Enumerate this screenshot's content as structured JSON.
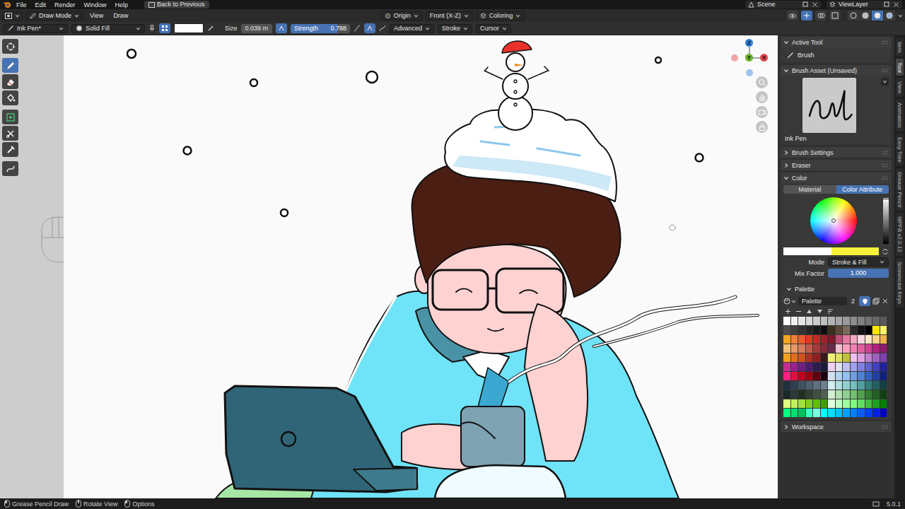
{
  "menu_bar": {
    "items": [
      "File",
      "Edit",
      "Render",
      "Window",
      "Help"
    ],
    "back_button": "Back to Previous",
    "scene": "Scene",
    "view_layer": "ViewLayer"
  },
  "header": {
    "mode": "Draw Mode",
    "menus": [
      "View",
      "Draw"
    ],
    "pivot": "Origin",
    "view": "Front (X-Z)",
    "layer": "Coloring",
    "shading": [
      {
        "selected": false
      },
      {
        "selected": false
      },
      {
        "selected": true
      },
      {
        "selected": false
      }
    ]
  },
  "tool_settings": {
    "brush": "Ink Pen*",
    "fill": "Solid Fill",
    "brush_color": "#ffffff",
    "size_label": "Size",
    "size": "0.039 m",
    "strength_label": "Strength",
    "strength": "0.788",
    "strength_level": 0.788,
    "menus": [
      "Advanced",
      "Stroke",
      "Cursor"
    ]
  },
  "toolbar": {
    "tools": [
      {
        "kind": "cursor",
        "selected": false
      },
      {
        "kind": "draw",
        "selected": true
      },
      {
        "kind": "erase",
        "selected": false
      },
      {
        "kind": "fill",
        "selected": false
      },
      {
        "kind": "tint",
        "selected": false
      },
      {
        "kind": "cutter",
        "selected": false
      },
      {
        "kind": "eyedropper",
        "selected": false
      },
      {
        "kind": "interpolate",
        "selected": false
      }
    ]
  },
  "gizmo": {
    "axes": [
      {
        "label": "Z",
        "color": "#2f7fdb"
      },
      {
        "label": "Y",
        "color": "#6cb32c"
      },
      {
        "label": "X",
        "color": "#e0474c"
      }
    ]
  },
  "sidebar": {
    "tabs": [
      {
        "label": "Item",
        "selected": false
      },
      {
        "label": "Tool",
        "selected": true
      },
      {
        "label": "View",
        "selected": false
      },
      {
        "label": "Animation",
        "selected": false
      },
      {
        "label": "Easy Tree",
        "selected": false
      },
      {
        "label": "Grease Pencil",
        "selected": false
      },
      {
        "label": "MPFB v2.0.12",
        "selected": false
      },
      {
        "label": "Screencast Keys",
        "selected": false
      }
    ],
    "active_tool": {
      "title": "Active Tool",
      "expanded": true,
      "tool": "Brush"
    },
    "brush_asset": {
      "title": "Brush Asset (Unsaved)",
      "expanded": true,
      "name": "Ink Pen"
    },
    "brush_settings": {
      "title": "Brush Settings",
      "expanded": false
    },
    "eraser": {
      "title": "Eraser",
      "expanded": false
    },
    "color": {
      "title": "Color",
      "expanded": true,
      "tabs": [
        {
          "label": "Material",
          "selected": false
        },
        {
          "label": "Color Attribute",
          "selected": true
        }
      ],
      "value_level": 1,
      "colors": [
        {
          "color": "#ffffff"
        },
        {
          "color": "#f6f23a"
        }
      ],
      "mode_label": "Mode",
      "mode": "Stroke & Fill",
      "mix_label": "Mix Factor",
      "mix": "1.000",
      "mix_level": 1,
      "palette": {
        "title": "Palette",
        "expanded": true,
        "name": "Palette",
        "users": "2",
        "swatches": [
          {
            "color": "#ffffff",
            "selected": true
          },
          {
            "color": "#f2f2f2",
            "selected": false
          },
          {
            "color": "#e6e6e6",
            "selected": false
          },
          {
            "color": "#d9d9d9",
            "selected": false
          },
          {
            "color": "#cccccc",
            "selected": false
          },
          {
            "color": "#bfbfbf",
            "selected": false
          },
          {
            "color": "#b3b3b3",
            "selected": false
          },
          {
            "color": "#a6a6a6",
            "selected": false
          },
          {
            "color": "#999999",
            "selected": false
          },
          {
            "color": "#8c8c8c",
            "selected": false
          },
          {
            "color": "#808080",
            "selected": false
          },
          {
            "color": "#737373",
            "selected": false
          },
          {
            "color": "#666666",
            "selected": false
          },
          {
            "color": "#595959",
            "selected": false
          },
          {
            "color": "#4d4d4d",
            "selected": false
          },
          {
            "color": "#404040",
            "selected": false
          },
          {
            "color": "#333333",
            "selected": false
          },
          {
            "color": "#262626",
            "selected": false
          },
          {
            "color": "#1a1a1a",
            "selected": false
          },
          {
            "color": "#0d0d0d",
            "selected": false
          },
          {
            "color": "#3a2e1e",
            "selected": false
          },
          {
            "color": "#5a4a3a",
            "selected": false
          },
          {
            "color": "#7a6a5a",
            "selected": false
          },
          {
            "color": "#2a2a2a",
            "selected": false
          },
          {
            "color": "#111111",
            "selected": false
          },
          {
            "color": "#000000",
            "selected": false
          },
          {
            "color": "#ffe600",
            "selected": false
          },
          {
            "color": "#fff26b",
            "selected": false
          },
          {
            "color": "#f5a623",
            "selected": false
          },
          {
            "color": "#f07f3c",
            "selected": false
          },
          {
            "color": "#e85d2a",
            "selected": false
          },
          {
            "color": "#e03c1f",
            "selected": false
          },
          {
            "color": "#c62828",
            "selected": false
          },
          {
            "color": "#a01f2a",
            "selected": false
          },
          {
            "color": "#7a1a2a",
            "selected": false
          },
          {
            "color": "#c0507a",
            "selected": false
          },
          {
            "color": "#e27aa0",
            "selected": false
          },
          {
            "color": "#f2a7c0",
            "selected": false
          },
          {
            "color": "#f7d6e0",
            "selected": false
          },
          {
            "color": "#fbe6c8",
            "selected": false
          },
          {
            "color": "#f5d08a",
            "selected": false
          },
          {
            "color": "#f0b44a",
            "selected": false
          },
          {
            "color": "#f3c27a",
            "selected": false
          },
          {
            "color": "#e89a6a",
            "selected": false
          },
          {
            "color": "#d77a5a",
            "selected": false
          },
          {
            "color": "#c45a4a",
            "selected": false
          },
          {
            "color": "#a63a3a",
            "selected": false
          },
          {
            "color": "#8a2a3a",
            "selected": false
          },
          {
            "color": "#6a2a4a",
            "selected": false
          },
          {
            "color": "#f0c0d0",
            "selected": false
          },
          {
            "color": "#f7a0c0",
            "selected": false
          },
          {
            "color": "#f080b0",
            "selected": false
          },
          {
            "color": "#e060a0",
            "selected": false
          },
          {
            "color": "#d04090",
            "selected": false
          },
          {
            "color": "#b02080",
            "selected": false
          },
          {
            "color": "#901a70",
            "selected": false
          },
          {
            "color": "#f0a020",
            "selected": false
          },
          {
            "color": "#e07020",
            "selected": false
          },
          {
            "color": "#d05020",
            "selected": false
          },
          {
            "color": "#b03020",
            "selected": false
          },
          {
            "color": "#902020",
            "selected": false
          },
          {
            "color": "#3a1a1a",
            "selected": false
          },
          {
            "color": "#f0f080",
            "selected": false
          },
          {
            "color": "#e0e060",
            "selected": false
          },
          {
            "color": "#c0c040",
            "selected": false
          },
          {
            "color": "#f0c0f0",
            "selected": false
          },
          {
            "color": "#e0a0e0",
            "selected": false
          },
          {
            "color": "#c080d0",
            "selected": false
          },
          {
            "color": "#a060c0",
            "selected": false
          },
          {
            "color": "#8040b0",
            "selected": false
          },
          {
            "color": "#c03090",
            "selected": false
          },
          {
            "color": "#9a2090",
            "selected": false
          },
          {
            "color": "#702080",
            "selected": false
          },
          {
            "color": "#501a70",
            "selected": false
          },
          {
            "color": "#301a50",
            "selected": false
          },
          {
            "color": "#1a1a3a",
            "selected": false
          },
          {
            "color": "#f0d0f0",
            "selected": false
          },
          {
            "color": "#e0e0f0",
            "selected": false
          },
          {
            "color": "#c0c0f0",
            "selected": false
          },
          {
            "color": "#a0a0f0",
            "selected": false
          },
          {
            "color": "#8080e0",
            "selected": false
          },
          {
            "color": "#6060d0",
            "selected": false
          },
          {
            "color": "#4040c0",
            "selected": false
          },
          {
            "color": "#2020a0",
            "selected": false
          },
          {
            "color": "#ff2080",
            "selected": false
          },
          {
            "color": "#e01040",
            "selected": false
          },
          {
            "color": "#c00020",
            "selected": false
          },
          {
            "color": "#a00010",
            "selected": false
          },
          {
            "color": "#600010",
            "selected": false
          },
          {
            "color": "#200010",
            "selected": false
          },
          {
            "color": "#d0e0f0",
            "selected": false
          },
          {
            "color": "#b0d0f0",
            "selected": false
          },
          {
            "color": "#90c0f0",
            "selected": false
          },
          {
            "color": "#70a0e0",
            "selected": false
          },
          {
            "color": "#5080d0",
            "selected": false
          },
          {
            "color": "#3060c0",
            "selected": false
          },
          {
            "color": "#2040a0",
            "selected": false
          },
          {
            "color": "#102080",
            "selected": false
          },
          {
            "color": "#203040",
            "selected": false
          },
          {
            "color": "#304050",
            "selected": false
          },
          {
            "color": "#405060",
            "selected": false
          },
          {
            "color": "#506070",
            "selected": false
          },
          {
            "color": "#607080",
            "selected": false
          },
          {
            "color": "#708090",
            "selected": false
          },
          {
            "color": "#d0f0f0",
            "selected": false
          },
          {
            "color": "#b0e0e0",
            "selected": false
          },
          {
            "color": "#90d0d0",
            "selected": false
          },
          {
            "color": "#70c0c0",
            "selected": false
          },
          {
            "color": "#50a0a0",
            "selected": false
          },
          {
            "color": "#308080",
            "selected": false
          },
          {
            "color": "#206060",
            "selected": false
          },
          {
            "color": "#104040",
            "selected": false
          },
          {
            "color": "#1a2a2a",
            "selected": false
          },
          {
            "color": "#2a3a3a",
            "selected": false
          },
          {
            "color": "#203020",
            "selected": false
          },
          {
            "color": "#304030",
            "selected": false
          },
          {
            "color": "#405040",
            "selected": false
          },
          {
            "color": "#506050",
            "selected": false
          },
          {
            "color": "#d0f0d0",
            "selected": false
          },
          {
            "color": "#b0e0b0",
            "selected": false
          },
          {
            "color": "#90d090",
            "selected": false
          },
          {
            "color": "#70c070",
            "selected": false
          },
          {
            "color": "#50a050",
            "selected": false
          },
          {
            "color": "#308030",
            "selected": false
          },
          {
            "color": "#206020",
            "selected": false
          },
          {
            "color": "#104010",
            "selected": false
          },
          {
            "color": "#e0ff80",
            "selected": false
          },
          {
            "color": "#c0f060",
            "selected": false
          },
          {
            "color": "#a0e040",
            "selected": false
          },
          {
            "color": "#80d020",
            "selected": false
          },
          {
            "color": "#60c000",
            "selected": false
          },
          {
            "color": "#40a000",
            "selected": false
          },
          {
            "color": "#e0ffe0",
            "selected": false
          },
          {
            "color": "#c0ffc0",
            "selected": false
          },
          {
            "color": "#a0ffa0",
            "selected": false
          },
          {
            "color": "#80ff80",
            "selected": false
          },
          {
            "color": "#60e060",
            "selected": false
          },
          {
            "color": "#40c040",
            "selected": false
          },
          {
            "color": "#20a020",
            "selected": false
          },
          {
            "color": "#008000",
            "selected": false
          },
          {
            "color": "#00ff80",
            "selected": false
          },
          {
            "color": "#00e070",
            "selected": false
          },
          {
            "color": "#00c060",
            "selected": false
          },
          {
            "color": "#40ffc0",
            "selected": false
          },
          {
            "color": "#80ffe0",
            "selected": false
          },
          {
            "color": "#00ffff",
            "selected": false
          },
          {
            "color": "#00e0ff",
            "selected": false
          },
          {
            "color": "#00c0ff",
            "selected": false
          },
          {
            "color": "#00a0ff",
            "selected": false
          },
          {
            "color": "#0080ff",
            "selected": false
          },
          {
            "color": "#0060ff",
            "selected": false
          },
          {
            "color": "#0040ff",
            "selected": false
          },
          {
            "color": "#0020e0",
            "selected": false
          },
          {
            "color": "#0000c0",
            "selected": false
          }
        ]
      }
    },
    "workspace": {
      "title": "Workspace",
      "expanded": false
    }
  },
  "status_bar": {
    "hints": [
      "Grease Pencil Draw",
      "Rotate View",
      "Options"
    ],
    "version": "5.0.1"
  }
}
